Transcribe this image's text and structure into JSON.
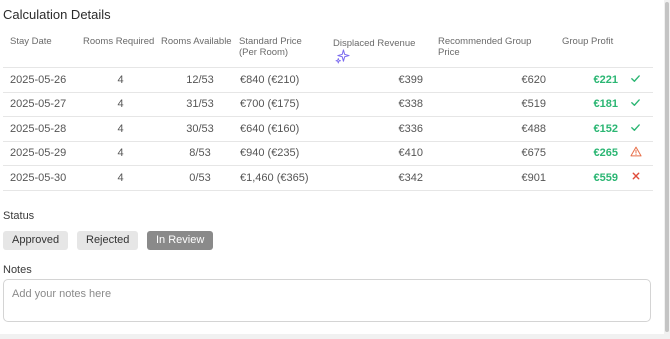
{
  "page": {
    "title": "Calculation Details"
  },
  "table": {
    "headers": {
      "stay_date": "Stay Date",
      "rooms_required": "Rooms Required",
      "rooms_available": "Rooms Available",
      "standard_price": "Standard Price",
      "standard_price_sub": "(Per Room)",
      "displaced_revenue": "Displaced Revenue",
      "recommended_group_price": "Recommended Group Price",
      "group_profit": "Group Profit"
    },
    "rows": [
      {
        "date": "2025-05-26",
        "rooms_required": "4",
        "rooms_available": "12/53",
        "standard_price": "€840 (€210)",
        "displaced_revenue": "€399",
        "recommended_price": "€620",
        "group_profit": "€221",
        "status_icon": "check-icon"
      },
      {
        "date": "2025-05-27",
        "rooms_required": "4",
        "rooms_available": "31/53",
        "standard_price": "€700 (€175)",
        "displaced_revenue": "€338",
        "recommended_price": "€519",
        "group_profit": "€181",
        "status_icon": "check-icon"
      },
      {
        "date": "2025-05-28",
        "rooms_required": "4",
        "rooms_available": "30/53",
        "standard_price": "€640 (€160)",
        "displaced_revenue": "€336",
        "recommended_price": "€488",
        "group_profit": "€152",
        "status_icon": "check-icon"
      },
      {
        "date": "2025-05-29",
        "rooms_required": "4",
        "rooms_available": "8/53",
        "standard_price": "€940 (€235)",
        "displaced_revenue": "€410",
        "recommended_price": "€675",
        "group_profit": "€265",
        "status_icon": "warning-icon"
      },
      {
        "date": "2025-05-30",
        "rooms_required": "4",
        "rooms_available": "0/53",
        "standard_price": "€1,460 (€365)",
        "displaced_revenue": "€342",
        "recommended_price": "€901",
        "group_profit": "€559",
        "status_icon": "cross-icon"
      }
    ]
  },
  "status": {
    "label": "Status",
    "options": {
      "approved": "Approved",
      "rejected": "Rejected",
      "in_review": "In Review"
    },
    "selected": "In Review"
  },
  "notes": {
    "label": "Notes",
    "placeholder": "Add your notes here",
    "value": ""
  },
  "colors": {
    "profit": "#2bb673",
    "check": "#2bb673",
    "warning": "#e8704a",
    "cross": "#e04b3a",
    "sparkle": "#7c6cf0",
    "selected_button": "#8a8a8a"
  }
}
